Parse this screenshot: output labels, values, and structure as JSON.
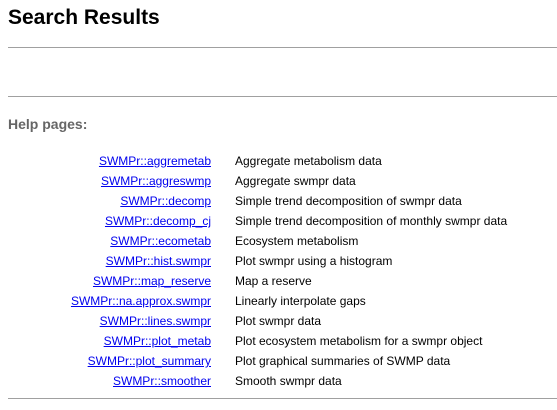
{
  "page": {
    "title": "Search Results",
    "section_heading": "Help pages:"
  },
  "results": [
    {
      "link": "SWMPr::aggremetab",
      "description": "Aggregate metabolism data"
    },
    {
      "link": "SWMPr::aggreswmp",
      "description": "Aggregate swmpr data"
    },
    {
      "link": "SWMPr::decomp",
      "description": "Simple trend decomposition of swmpr data"
    },
    {
      "link": "SWMPr::decomp_cj",
      "description": "Simple trend decomposition of monthly swmpr data"
    },
    {
      "link": "SWMPr::ecometab",
      "description": "Ecosystem metabolism"
    },
    {
      "link": "SWMPr::hist.swmpr",
      "description": "Plot swmpr using a histogram"
    },
    {
      "link": "SWMPr::map_reserve",
      "description": "Map a reserve"
    },
    {
      "link": "SWMPr::na.approx.swmpr",
      "description": "Linearly interpolate gaps"
    },
    {
      "link": "SWMPr::lines.swmpr",
      "description": "Plot swmpr data"
    },
    {
      "link": "SWMPr::plot_metab",
      "description": "Plot ecosystem metabolism for a swmpr object"
    },
    {
      "link": "SWMPr::plot_summary",
      "description": "Plot graphical summaries of SWMP data"
    },
    {
      "link": "SWMPr::smoother",
      "description": "Smooth swmpr data"
    }
  ],
  "colors": {
    "link": "#0000ee",
    "heading": "#666666",
    "rule": "#a0a0a0"
  }
}
